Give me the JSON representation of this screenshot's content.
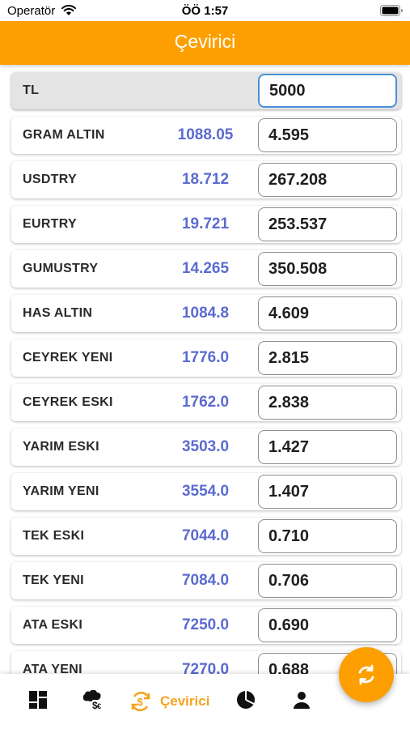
{
  "status_bar": {
    "carrier": "Operatör",
    "time": "ÖÖ 1:57"
  },
  "header": {
    "title": "Çevirici"
  },
  "base_row": {
    "name": "TL",
    "input_value": "5000"
  },
  "rows": [
    {
      "name": "GRAM ALTIN",
      "rate": "1088.05",
      "result": "4.595"
    },
    {
      "name": "USDTRY",
      "rate": "18.712",
      "result": "267.208"
    },
    {
      "name": "EURTRY",
      "rate": "19.721",
      "result": "253.537"
    },
    {
      "name": "GUMUSTRY",
      "rate": "14.265",
      "result": "350.508"
    },
    {
      "name": "HAS ALTIN",
      "rate": "1084.8",
      "result": "4.609"
    },
    {
      "name": "CEYREK YENI",
      "rate": "1776.0",
      "result": "2.815"
    },
    {
      "name": "CEYREK ESKI",
      "rate": "1762.0",
      "result": "2.838"
    },
    {
      "name": "YARIM ESKI",
      "rate": "3503.0",
      "result": "1.427"
    },
    {
      "name": "YARIM YENI",
      "rate": "3554.0",
      "result": "1.407"
    },
    {
      "name": "TEK ESKI",
      "rate": "7044.0",
      "result": "0.710"
    },
    {
      "name": "TEK YENI",
      "rate": "7084.0",
      "result": "0.706"
    },
    {
      "name": "ATA ESKI",
      "rate": "7250.0",
      "result": "0.690"
    },
    {
      "name": "ATA YENI",
      "rate": "7270.0",
      "result": "0.688"
    }
  ],
  "bottom_nav": {
    "items": [
      {
        "icon": "dashboard-icon"
      },
      {
        "icon": "exchange-rates-icon"
      },
      {
        "icon": "currency-converter-icon",
        "label": "Çevirici",
        "active": true
      },
      {
        "icon": "pie-chart-icon"
      },
      {
        "icon": "user-icon"
      }
    ]
  },
  "fab": {
    "icon": "refresh-icon"
  },
  "colors": {
    "accent": "#fd9f01",
    "rate_text": "#5b6bd0",
    "active_nav": "#f6a31e",
    "focus_border": "#4a90d9"
  }
}
